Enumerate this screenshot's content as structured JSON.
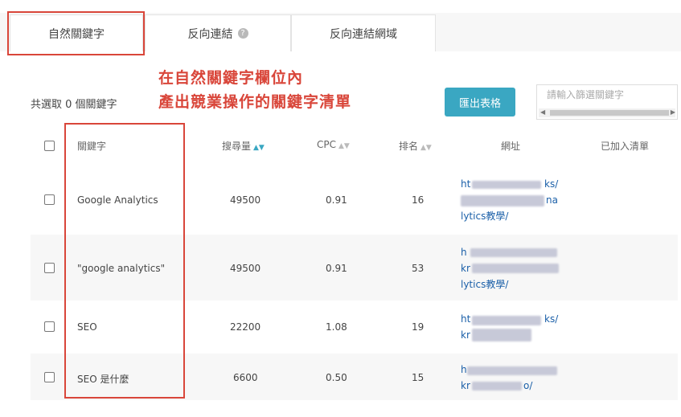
{
  "tabs": [
    {
      "label": "自然關鍵字"
    },
    {
      "label": "反向連結"
    },
    {
      "label": "反向連結網域"
    }
  ],
  "annotation": {
    "line1": "在自然關鍵字欄位內",
    "line2": "產出競業操作的關鍵字清單"
  },
  "toolbar": {
    "selected_count": "共選取 0 個關鍵字",
    "export_label": "匯出表格",
    "search_placeholder": "請輸入篩選關鍵字"
  },
  "table": {
    "headers": {
      "keyword": "關鍵字",
      "volume": "搜尋量",
      "cpc": "CPC",
      "rank": "排名",
      "url": "網址",
      "added": "已加入清單"
    },
    "rows": [
      {
        "keyword": "Google Analytics",
        "volume": "49500",
        "cpc": "0.91",
        "rank": "16",
        "url_l1": "ht",
        "url_l2": "ks/",
        "url_l3": "na",
        "url_l4": "lytics教學/"
      },
      {
        "keyword": "\"google analytics\"",
        "volume": "49500",
        "cpc": "0.91",
        "rank": "53",
        "url_l1": "h",
        "url_l2": "kr",
        "url_l3": "lytics教學/"
      },
      {
        "keyword": "SEO",
        "volume": "22200",
        "cpc": "1.08",
        "rank": "19",
        "url_l1": "ht",
        "url_l2": "ks/",
        "url_l3": "kr"
      },
      {
        "keyword": "SEO 是什麼",
        "volume": "6600",
        "cpc": "0.50",
        "rank": "15",
        "url_l1": "h",
        "url_l2": "kr",
        "url_l3": "o/"
      }
    ]
  },
  "colors": {
    "accent": "#3aa7c2",
    "annotation_red": "#d9463a",
    "link": "#1a5fa8"
  }
}
